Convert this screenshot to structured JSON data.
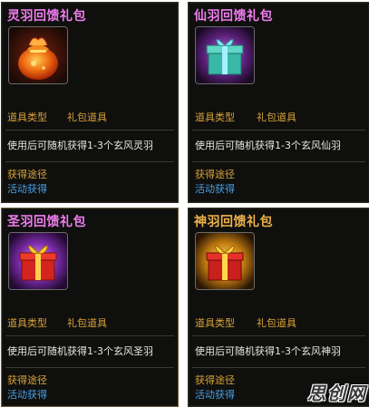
{
  "cards": [
    {
      "title": "灵羽回馈礼包",
      "title_color": "#e8c0ff",
      "icon": "orange-pouch-icon",
      "type_label": "道具类型",
      "type_value": "礼包道具",
      "description": "使用后可随机获得1-3个玄风灵羽",
      "source_label": "获得途径",
      "source_value": "活动获得"
    },
    {
      "title": "仙羽回馈礼包",
      "title_color": "#f07ef0",
      "icon": "teal-gift-box-icon",
      "type_label": "道具类型",
      "type_value": "礼包道具",
      "description": "使用后可随机获得1-3个玄风仙羽",
      "source_label": "获得途径",
      "source_value": "活动获得"
    },
    {
      "title": "圣羽回馈礼包",
      "title_color": "#f07ef0",
      "icon": "red-gift-box-purple-glow-icon",
      "type_label": "道具类型",
      "type_value": "礼包道具",
      "description": "使用后可随机获得1-3个玄风圣羽",
      "source_label": "获得途径",
      "source_value": "活动获得"
    },
    {
      "title": "神羽回馈礼包",
      "title_color": "#f0b24a",
      "icon": "red-gift-box-gold-glow-icon",
      "type_label": "道具类型",
      "type_value": "礼包道具",
      "description": "使用后可随机获得1-3个玄风神羽",
      "source_label": "获得途径",
      "source_value": "活动获得"
    }
  ],
  "watermark": "思创网"
}
